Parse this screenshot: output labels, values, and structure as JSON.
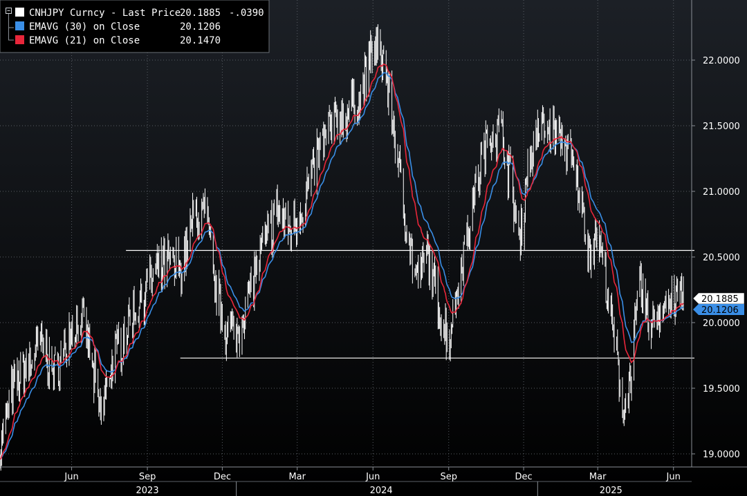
{
  "colors": {
    "background_top": "#1c2026",
    "background_bottom": "#000000",
    "grid": "#5a5f66",
    "price": "#ffffff",
    "ema30": "#3a8ee6",
    "ema21": "#e8263a",
    "hline": "#ffffff",
    "axis_text": "#ffffff"
  },
  "legend": {
    "rows": [
      {
        "label": "CNHJPY Curncy - Last Price",
        "value": "20.1885",
        "change": "-.0390",
        "swatch": "#ffffff"
      },
      {
        "label": "EMAVG (30)  on Close",
        "value": "20.1206",
        "change": "",
        "swatch": "#3a8ee6"
      },
      {
        "label": "EMAVG (21)  on Close",
        "value": "20.1470",
        "change": "",
        "swatch": "#e8263a"
      }
    ],
    "collapse_icon": "minus-box-icon"
  },
  "last_value_tags": [
    {
      "text": "20.1885",
      "value": 20.1885,
      "bg": "#ffffff",
      "fg": "#000000"
    },
    {
      "text": "20.1206",
      "value": 20.1206,
      "bg": "#3a8ee6",
      "fg": "#000000"
    }
  ],
  "chart_data": {
    "type": "line",
    "title": "CNHJPY Curncy - Last Price",
    "xlabel": "",
    "ylabel": "",
    "ylim": [
      18.95,
      22.45
    ],
    "y_ticks": [
      "22.0000",
      "21.5000",
      "21.0000",
      "20.5000",
      "20.0000",
      "19.5000",
      "19.0000"
    ],
    "y_tick_values": [
      22.0,
      21.5,
      21.0,
      20.5,
      20.0,
      19.5,
      19.0
    ],
    "x_month_labels": [
      "Jun",
      "Sep",
      "Dec",
      "Mar",
      "Jun",
      "Sep",
      "Dec",
      "Mar",
      "Jun"
    ],
    "x_month_dates": [
      "2023-06-15",
      "2023-09-15",
      "2023-12-15",
      "2024-03-15",
      "2024-06-15",
      "2024-09-15",
      "2024-12-15",
      "2025-03-15",
      "2025-06-15"
    ],
    "x_years": [
      "2023",
      "2024",
      "2025"
    ],
    "x_year_dates": [
      "2023-09-15",
      "2024-06-25",
      "2025-03-31"
    ],
    "x_range": [
      "2023-03-20",
      "2025-06-27"
    ],
    "grid": true,
    "legend_position": "top-left",
    "horizontal_lines": [
      {
        "value": 20.55,
        "from": "2023-08-20",
        "to": "2025-06-27"
      },
      {
        "value": 19.73,
        "from": "2023-10-25",
        "to": "2025-06-27"
      }
    ],
    "anchors": [
      [
        "2023-03-20",
        19.05
      ],
      [
        "2023-04-05",
        19.5
      ],
      [
        "2023-04-20",
        19.65
      ],
      [
        "2023-05-10",
        19.85
      ],
      [
        "2023-05-25",
        19.6
      ],
      [
        "2023-06-15",
        19.95
      ],
      [
        "2023-07-01",
        20.0
      ],
      [
        "2023-07-10",
        19.65
      ],
      [
        "2023-07-20",
        19.3
      ],
      [
        "2023-08-01",
        19.65
      ],
      [
        "2023-08-20",
        19.95
      ],
      [
        "2023-09-15",
        20.3
      ],
      [
        "2023-10-10",
        20.45
      ],
      [
        "2023-10-25",
        20.4
      ],
      [
        "2023-11-10",
        20.8
      ],
      [
        "2023-11-25",
        20.85
      ],
      [
        "2023-12-05",
        20.3
      ],
      [
        "2023-12-20",
        19.95
      ],
      [
        "2024-01-01",
        19.9
      ],
      [
        "2024-01-15",
        20.2
      ],
      [
        "2024-02-01",
        20.55
      ],
      [
        "2024-02-20",
        20.85
      ],
      [
        "2024-03-05",
        20.7
      ],
      [
        "2024-03-15",
        20.8
      ],
      [
        "2024-03-25",
        20.95
      ],
      [
        "2024-04-10",
        21.3
      ],
      [
        "2024-04-25",
        21.5
      ],
      [
        "2024-05-15",
        21.6
      ],
      [
        "2024-06-01",
        21.75
      ],
      [
        "2024-06-15",
        22.1
      ],
      [
        "2024-06-28",
        22.0
      ],
      [
        "2024-07-10",
        21.5
      ],
      [
        "2024-07-20",
        21.0
      ],
      [
        "2024-08-01",
        20.5
      ],
      [
        "2024-08-10",
        20.3
      ],
      [
        "2024-08-20",
        20.55
      ],
      [
        "2024-09-01",
        20.15
      ],
      [
        "2024-09-15",
        19.85
      ],
      [
        "2024-09-25",
        20.25
      ],
      [
        "2024-10-05",
        20.6
      ],
      [
        "2024-10-20",
        21.1
      ],
      [
        "2024-11-05",
        21.45
      ],
      [
        "2024-11-20",
        21.45
      ],
      [
        "2024-12-01",
        21.0
      ],
      [
        "2024-12-10",
        20.6
      ],
      [
        "2024-12-20",
        21.2
      ],
      [
        "2025-01-05",
        21.5
      ],
      [
        "2025-01-20",
        21.45
      ],
      [
        "2025-02-05",
        21.35
      ],
      [
        "2025-02-20",
        21.0
      ],
      [
        "2025-03-05",
        20.55
      ],
      [
        "2025-03-15",
        20.7
      ],
      [
        "2025-03-25",
        20.3
      ],
      [
        "2025-04-05",
        19.8
      ],
      [
        "2025-04-15",
        19.35
      ],
      [
        "2025-04-25",
        19.65
      ],
      [
        "2025-05-05",
        20.3
      ],
      [
        "2025-05-15",
        20.0
      ],
      [
        "2025-05-25",
        20.05
      ],
      [
        "2025-06-05",
        20.15
      ],
      [
        "2025-06-20",
        20.2
      ],
      [
        "2025-06-27",
        20.19
      ]
    ],
    "series": [
      {
        "name": "CNHJPY Curncy - Last Price",
        "style": "daily-high-low-bars",
        "last": 20.1885
      },
      {
        "name": "EMAVG (30)  on Close",
        "style": "line",
        "period": 30,
        "last": 20.1206
      },
      {
        "name": "EMAVG (21)  on Close",
        "style": "line",
        "period": 21,
        "last": 20.147
      }
    ]
  }
}
